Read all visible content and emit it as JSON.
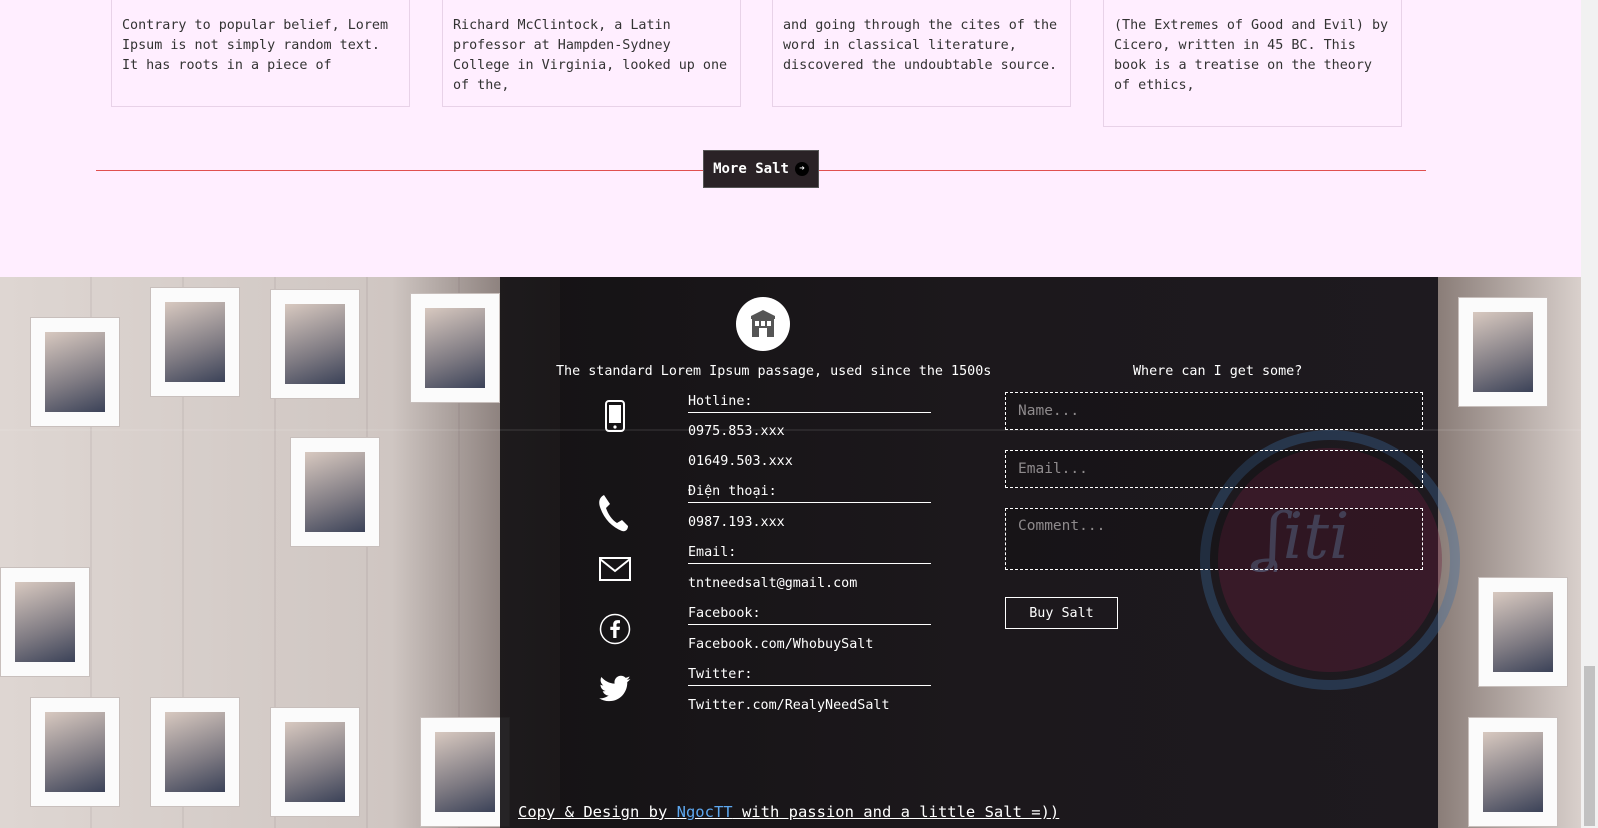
{
  "cards": [
    {
      "text": "Contrary to popular belief, Lorem Ipsum is not simply random text. It has roots in a piece of"
    },
    {
      "text": "Richard McClintock, a Latin professor at Hampden-Sydney College in Virginia, looked up one of the,"
    },
    {
      "text": "and going through the cites of the word in classical literature, discovered the undoubtable source."
    },
    {
      "text": "(The Extremes of Good and Evil) by Cicero, written in 45 BC. This book is a treatise on the theory of ethics,"
    }
  ],
  "more_button": {
    "label": "More Salt"
  },
  "footer": {
    "contact_title": "The standard Lorem Ipsum passage, used since the 1500s",
    "form_title": "Where can I get some?",
    "hotline_label": "Hotline:",
    "hotline_1": "0975.853.xxx",
    "hotline_2": "01649.503.xxx",
    "phone_label": "Điện thoại:",
    "phone_value": "0987.193.xxx",
    "email_label": "Email:",
    "email_value": "tntneedsalt@gmail.com",
    "facebook_label": "Facebook:",
    "facebook_value": "Facebook.com/WhobuySalt",
    "twitter_label": "Twitter:",
    "twitter_value": "Twitter.com/RealyNeedSalt",
    "form": {
      "name_placeholder": "Name...",
      "email_placeholder": "Email...",
      "comment_placeholder": "Comment...",
      "submit_label": "Buy Salt"
    },
    "copyright_prefix": "Copy & Design by ",
    "copyright_author": "NgocTT",
    "copyright_suffix": " with passion and a little Salt =))"
  },
  "icons": [
    "store-icon",
    "mobile-phone-icon",
    "telephone-icon",
    "mail-icon",
    "facebook-icon",
    "twitter-icon",
    "arrow-right-icon"
  ],
  "colors": {
    "page_bg": "#ffeeff",
    "divider": "#e05050",
    "footer_dark": "#1a1718",
    "link": "#5da7ef"
  }
}
